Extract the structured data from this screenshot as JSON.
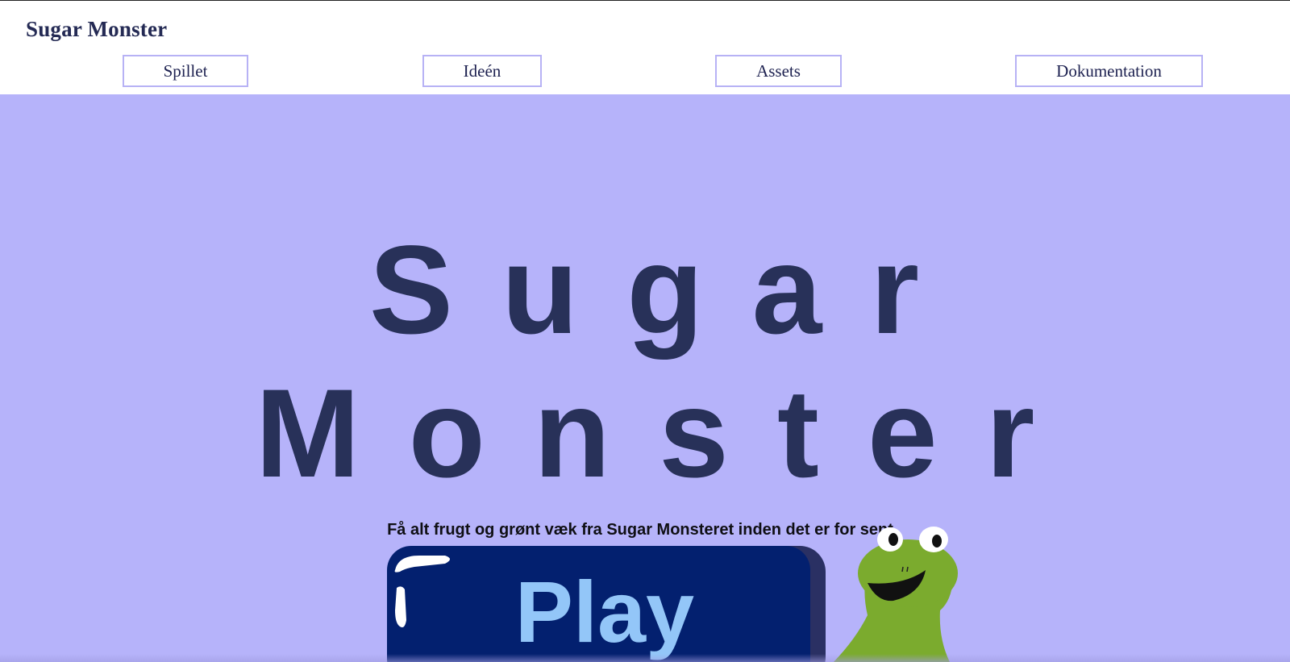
{
  "header": {
    "site_title": "Sugar Monster",
    "nav": [
      {
        "label": "Spillet"
      },
      {
        "label": "Ideén"
      },
      {
        "label": "Assets"
      },
      {
        "label": "Dokumentation"
      }
    ]
  },
  "hero": {
    "title_line_1": "Sugar",
    "title_line_2": "Monster",
    "tagline": "Få alt frugt og grønt væk fra Sugar Monsteret inden det er for sent",
    "play_label": "Play",
    "mascot_icon": "green-frog-monster-icon"
  },
  "colors": {
    "hero_background": "#b6b3fa",
    "title_text": "#283159",
    "nav_border": "#b7b2f5",
    "play_button": "#03206f",
    "play_text": "#93c6f8",
    "frog_green": "#7bab2e"
  }
}
